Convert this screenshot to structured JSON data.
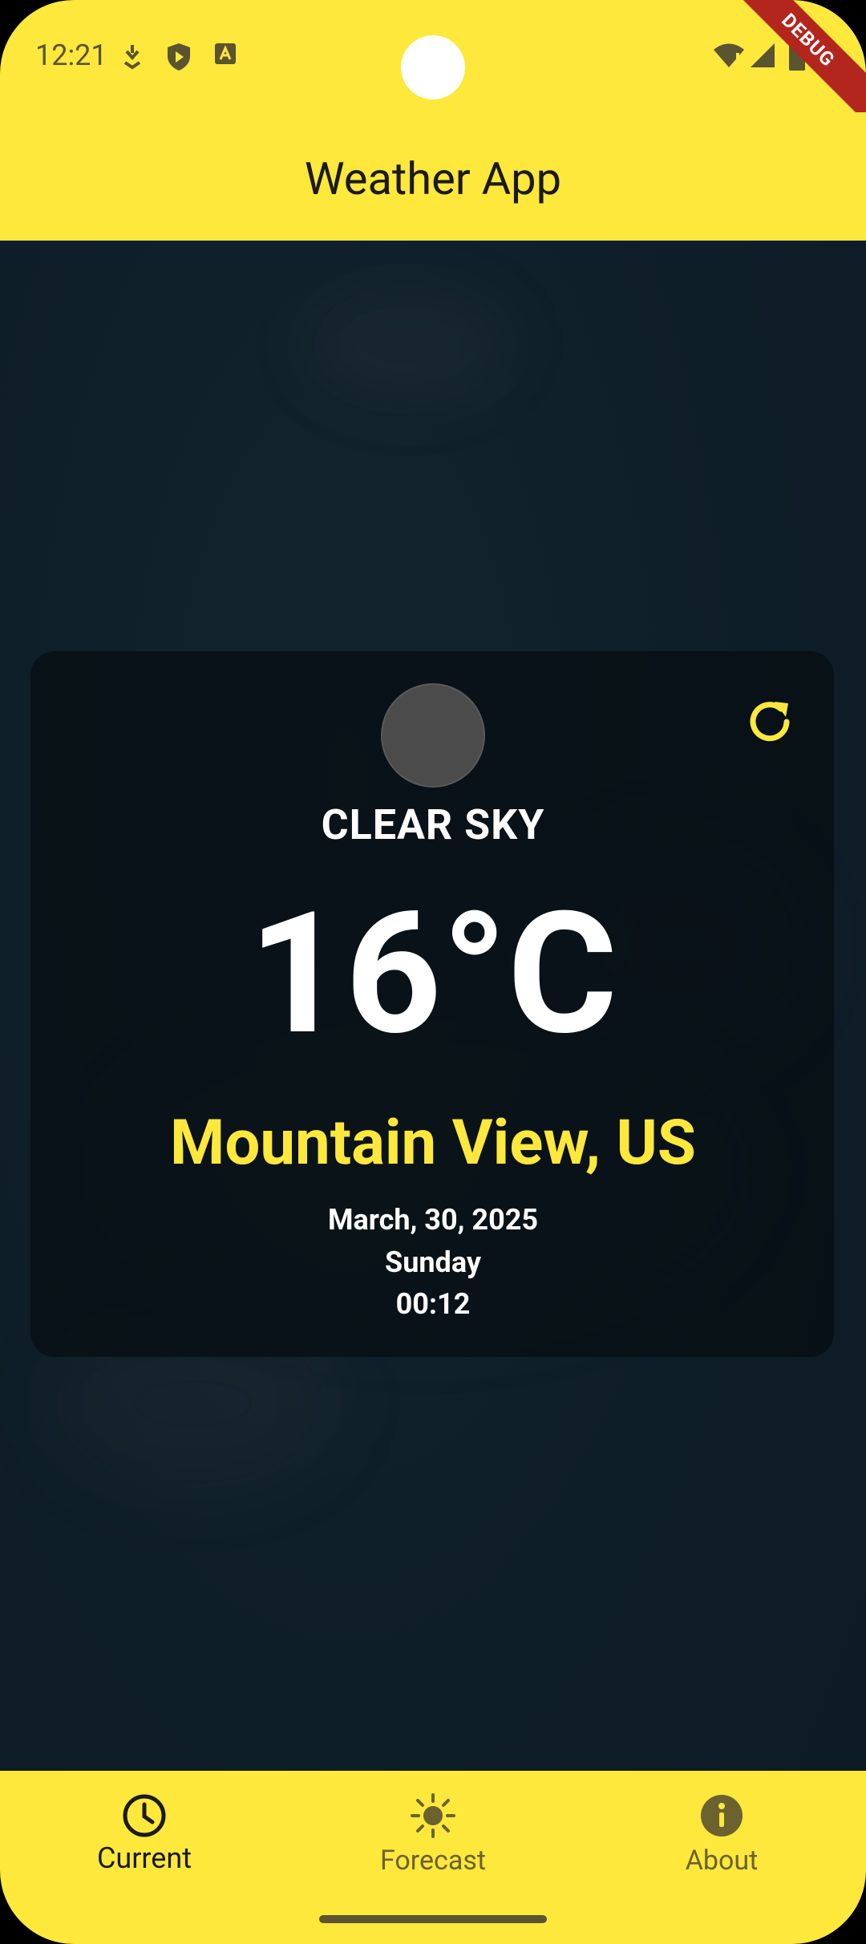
{
  "status_bar": {
    "time": "12:21",
    "icons": [
      "cast-icon",
      "shield-play-icon",
      "font-icon",
      "wifi-alert-icon",
      "signal-icon",
      "battery-icon"
    ],
    "debug_label": "DEBUG"
  },
  "app_bar": {
    "title": "Weather App"
  },
  "weather": {
    "condition": "CLEAR SKY",
    "temperature": "16°C",
    "location": "Mountain View, US",
    "date": "March, 30, 2025",
    "day": "Sunday",
    "time": "00:12",
    "refresh_icon": "refresh-icon"
  },
  "nav": {
    "items": [
      {
        "label": "Current",
        "icon": "clock-icon",
        "active": true
      },
      {
        "label": "Forecast",
        "icon": "sun-icon",
        "active": false
      },
      {
        "label": "About",
        "icon": "info-icon",
        "active": false
      }
    ]
  },
  "colors": {
    "accent": "#fde83b",
    "background": "#0f1f29",
    "active_nav": "#1a1a1a",
    "inactive_nav": "#6b6230"
  }
}
